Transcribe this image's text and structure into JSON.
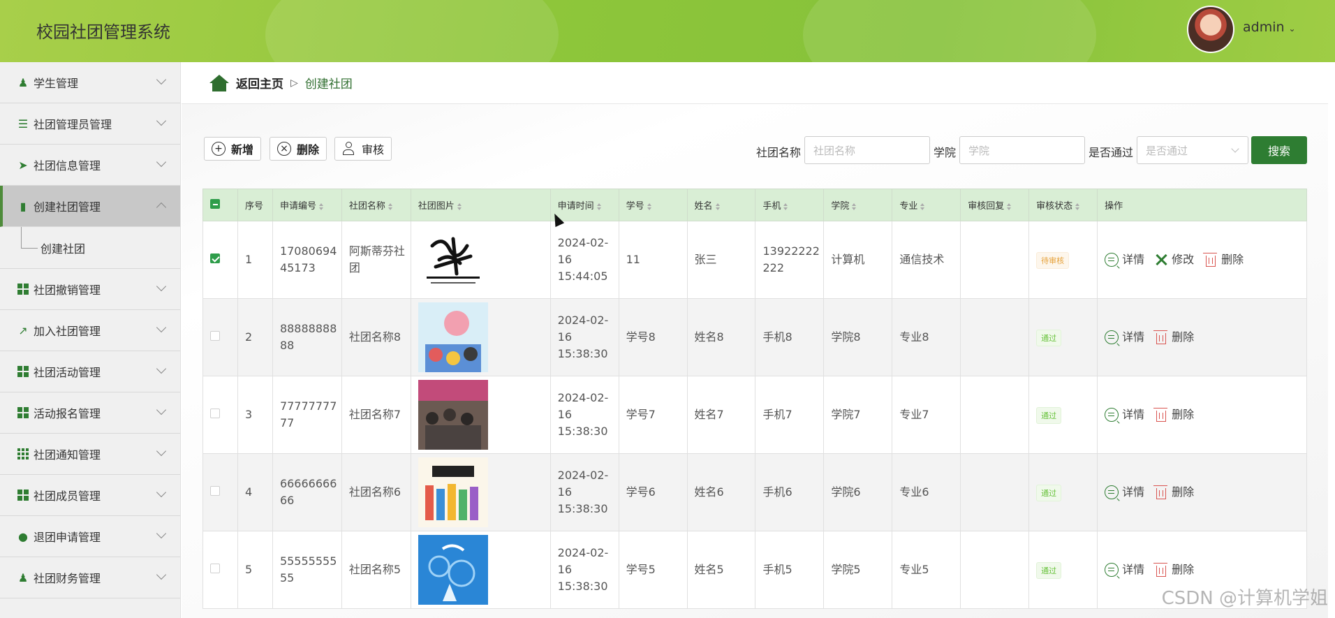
{
  "app": {
    "title": "校园社团管理系统"
  },
  "header": {
    "username": "admin",
    "dropdown_icon": "chevron-down-icon"
  },
  "sidebar": {
    "items": [
      {
        "label": "学生管理",
        "icon": "user-icon"
      },
      {
        "label": "社团管理员管理",
        "icon": "list-icon"
      },
      {
        "label": "社团信息管理",
        "icon": "send-icon"
      },
      {
        "label": "创建社团管理",
        "icon": "clipboard-icon",
        "active": true
      },
      {
        "label": "社团撤销管理",
        "icon": "grid-icon"
      },
      {
        "label": "加入社团管理",
        "icon": "chart-icon"
      },
      {
        "label": "社团活动管理",
        "icon": "grid-icon"
      },
      {
        "label": "活动报名管理",
        "icon": "grid-icon"
      },
      {
        "label": "社团通知管理",
        "icon": "apps-icon"
      },
      {
        "label": "社团成员管理",
        "icon": "grid-icon"
      },
      {
        "label": "退团申请管理",
        "icon": "bulb-icon"
      },
      {
        "label": "社团财务管理",
        "icon": "users-icon"
      }
    ],
    "sub_item": "创建社团"
  },
  "breadcrumb": {
    "home": "返回主页",
    "current": "创建社团"
  },
  "toolbar": {
    "add": "新增",
    "delete": "删除",
    "review": "审核"
  },
  "search": {
    "name_label": "社团名称",
    "name_placeholder": "社团名称",
    "college_label": "学院",
    "college_placeholder": "学院",
    "pass_label": "是否通过",
    "pass_placeholder": "是否通过",
    "button": "搜索"
  },
  "table": {
    "headers": [
      "序号",
      "申请编号",
      "社团名称",
      "社团图片",
      "申请时间",
      "学号",
      "姓名",
      "手机",
      "学院",
      "专业",
      "审核回复",
      "审核状态",
      "操作"
    ],
    "rows": [
      {
        "idx": "1",
        "app_no": "1708069445173",
        "name": "阿斯蒂芬社团",
        "time": "2024-02-16 15:44:05",
        "sid": "11",
        "sname": "张三",
        "phone": "13922222222",
        "college": "计算机",
        "major": "通信技术",
        "reply": "",
        "status": "待审核",
        "checked": true,
        "ops": [
          "详情",
          "修改",
          "删除"
        ]
      },
      {
        "idx": "2",
        "app_no": "8888888888",
        "name": "社团名称8",
        "time": "2024-02-16 15:38:30",
        "sid": "学号8",
        "sname": "姓名8",
        "phone": "手机8",
        "college": "学院8",
        "major": "专业8",
        "reply": "",
        "status": "通过",
        "checked": false,
        "ops": [
          "详情",
          "删除"
        ]
      },
      {
        "idx": "3",
        "app_no": "7777777777",
        "name": "社团名称7",
        "time": "2024-02-16 15:38:30",
        "sid": "学号7",
        "sname": "姓名7",
        "phone": "手机7",
        "college": "学院7",
        "major": "专业7",
        "reply": "",
        "status": "通过",
        "checked": false,
        "ops": [
          "详情",
          "删除"
        ]
      },
      {
        "idx": "4",
        "app_no": "6666666666",
        "name": "社团名称6",
        "time": "2024-02-16 15:38:30",
        "sid": "学号6",
        "sname": "姓名6",
        "phone": "手机6",
        "college": "学院6",
        "major": "专业6",
        "reply": "",
        "status": "通过",
        "checked": false,
        "ops": [
          "详情",
          "删除"
        ]
      },
      {
        "idx": "5",
        "app_no": "5555555555",
        "name": "社团名称5",
        "time": "2024-02-16 15:38:30",
        "sid": "学号5",
        "sname": "姓名5",
        "phone": "手机5",
        "college": "学院5",
        "major": "专业5",
        "reply": "",
        "status": "通过",
        "checked": false,
        "ops": [
          "详情",
          "删除"
        ]
      }
    ]
  },
  "watermark": "CSDN @计算机学姐",
  "colors": {
    "header": "#8ec63a",
    "accent": "#2e7d32",
    "table_header": "#d9eed5",
    "pending": "#e6a23c",
    "pass": "#67c23a",
    "danger": "#d9534f"
  }
}
